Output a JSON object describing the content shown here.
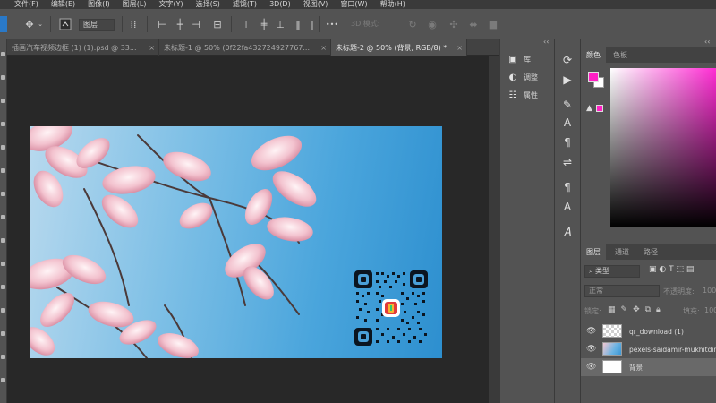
{
  "menubar": {
    "items": [
      "文件(F)",
      "编辑(E)",
      "图像(I)",
      "图层(L)",
      "文字(Y)",
      "选择(S)",
      "滤镜(T)",
      "3D(D)",
      "视图(V)",
      "窗口(W)",
      "帮助(H)"
    ]
  },
  "options": {
    "layer_select": "图层",
    "mode3d": "3D 模式:",
    "more": "•••"
  },
  "tabs": [
    {
      "label": "插画汽车视频边框 (1) (1).psd @ 33...",
      "active": false
    },
    {
      "label": "未标题-1 @ 50% (0f22fa432724927767...",
      "active": false
    },
    {
      "label": "未标题-2 @ 50% (背景, RGB/8) *",
      "active": true
    }
  ],
  "mid_panel": {
    "items": [
      {
        "label": "库",
        "icon": "library-icon"
      },
      {
        "label": "调整",
        "icon": "adjustments-icon"
      },
      {
        "label": "属性",
        "icon": "properties-icon"
      }
    ]
  },
  "color_panel": {
    "tabs": [
      "颜色",
      "色板"
    ],
    "foreground": "#ff1fc4",
    "background": "#ffffff"
  },
  "layers_panel": {
    "tabs": [
      "图层",
      "通道",
      "路径"
    ],
    "filter_label": "类型",
    "blend_mode": "正常",
    "opacity_label": "不透明度:",
    "opacity_value": "100",
    "lock_label": "锁定:",
    "fill_label": "填充:",
    "fill_value": "100",
    "layers": [
      {
        "name": "qr_download (1)",
        "selected": false
      },
      {
        "name": "pexels-saidamir-mukhitdinov",
        "selected": false
      },
      {
        "name": "背景",
        "selected": true
      }
    ]
  }
}
